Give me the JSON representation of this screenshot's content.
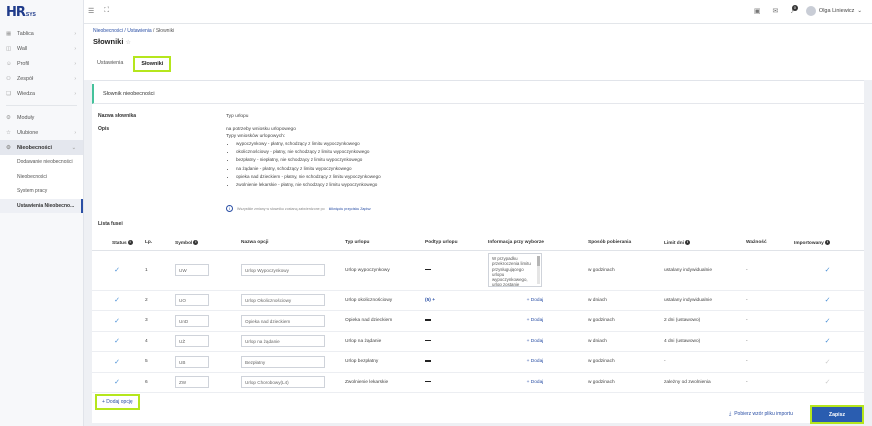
{
  "app": {
    "logo_main": "HR",
    "logo_sub": "SYS"
  },
  "sidebar": {
    "items": [
      {
        "label": "Tablica",
        "icon": "dashboard-icon",
        "chevron": "›"
      },
      {
        "label": "Wall",
        "icon": "wall-icon",
        "chevron": "›"
      },
      {
        "label": "Profil",
        "icon": "profile-icon",
        "chevron": "›"
      },
      {
        "label": "Zespół",
        "icon": "team-icon",
        "chevron": "›"
      },
      {
        "label": "Wiedza",
        "icon": "knowledge-icon",
        "chevron": "›"
      }
    ],
    "items2": [
      {
        "label": "Moduły",
        "icon": "modules-icon"
      },
      {
        "label": "Ulubione",
        "icon": "favorites-icon",
        "chevron": "›"
      },
      {
        "label": "Nieobecności",
        "icon": "absence-icon",
        "chevron": "⌄"
      }
    ],
    "sub": [
      {
        "label": "Dodawanie nieobecności"
      },
      {
        "label": "Nieobecności"
      },
      {
        "label": "System pracy"
      },
      {
        "label": "Ustawienia Nieobecno..."
      }
    ]
  },
  "topbar": {
    "user_name": "Olga Liniewicz",
    "notif_count": "0"
  },
  "breadcrumb": {
    "part1": "Nieobecności",
    "sep": " / ",
    "part2": "Ustawienia",
    "part3": "Słowniki"
  },
  "page": {
    "title": "Słowniki",
    "star": "☆"
  },
  "tabs": {
    "settings": "Ustawienia",
    "dicts": "Słowniki"
  },
  "card": {
    "header": "Słownik nieobecności",
    "dict_name_label": "Nazwa słownika",
    "dict_name_value": "Typ urlopu",
    "desc_label": "Opis",
    "desc_line1": "na potrzeby wniosku urlopowego",
    "desc_line2": "Typy wniosków urlopowych:",
    "desc_items": [
      "wypoczynkowy - płatny, schodzący z limitu wypoczynkowego",
      "okolicznościowy - płatny, nie schodzący z limitu wypoczynkowego",
      "bezpłatny - niepłatny, nie schodzący z limitu wypoczynkowego",
      "na żądanie - płatny, schodzący z limitu wypoczynkowego",
      "opieka nad dzieckiem - płatny, nie schodzący z limitu wypoczynkowego",
      "zwolnienie lekarskie - płatny, nie schodzący z limitu wypoczynkowego"
    ],
    "note_text": "Wszystkie zmiany w słowniku zostaną zatwierdzone po",
    "note_link": "kliknięciu przycisku Zapisz",
    "list_label": "Lista fusei"
  },
  "table": {
    "headers": {
      "status": "Status",
      "lp": "Lp.",
      "symbol": "Symbol",
      "name": "Nazwa opcji",
      "type": "Typ urlopu",
      "subtype": "Podtyp urlopu",
      "info": "Informacja przy wyborze",
      "method": "Sposób pobierania",
      "limit": "Limit dni",
      "validity": "Ważność",
      "imported": "Importowany"
    },
    "rows": [
      {
        "lp": "1",
        "symbol": "UW",
        "name": "Urlop Wypoczynkowy",
        "type": "Urlop wypoczynkowy",
        "subtype": "",
        "info_text": "W przypadku przekroczenia limitu przysługującego urlopu wypoczynkowego, urlop zostanie rozliczony jako bezpłatny",
        "method": "w godzinach",
        "limit": "ustalany indywidualnie",
        "validity": "-"
      },
      {
        "lp": "2",
        "symbol": "UO",
        "name": "Urlop Okolicznościowy",
        "type": "Urlop okolicznościowy",
        "subtype": "(5)",
        "info_add": "+ Dodaj",
        "method": "w dniach",
        "limit": "ustalany indywidualnie",
        "validity": "-"
      },
      {
        "lp": "3",
        "symbol": "UnD",
        "name": "Opieka nad dzieckiem",
        "type": "Opieka nad dzieckiem",
        "subtype": "",
        "info_add": "+ Dodaj",
        "method": "w godzinach",
        "limit": "2 dni (ustawowo)",
        "validity": "-"
      },
      {
        "lp": "4",
        "symbol": "UŻ",
        "name": "Urlop na żądanie",
        "type": "Urlop na żądanie",
        "subtype": "",
        "info_add": "+ Dodaj",
        "method": "w dniach",
        "limit": "4 dni (ustawowo)",
        "validity": "-"
      },
      {
        "lp": "5",
        "symbol": "UB",
        "name": "Bezpłatny",
        "type": "Urlop bezpłatny",
        "subtype": "",
        "info_add": "+ Dodaj",
        "method": "w godzinach",
        "limit": "-",
        "validity": "-"
      },
      {
        "lp": "6",
        "symbol": "ZW",
        "name": "Urlop Chorobowy(L4)",
        "type": "Zwolnienie lekarskie",
        "subtype": "",
        "info_add": "+ Dodaj",
        "method": "w godzinach",
        "limit": "zależny od zwolnienia",
        "validity": "-"
      }
    ]
  },
  "actions": {
    "add_row": "+ Dodaj opcję",
    "download": "Pobierz wzór pliku importu",
    "save": "Zapisz"
  }
}
